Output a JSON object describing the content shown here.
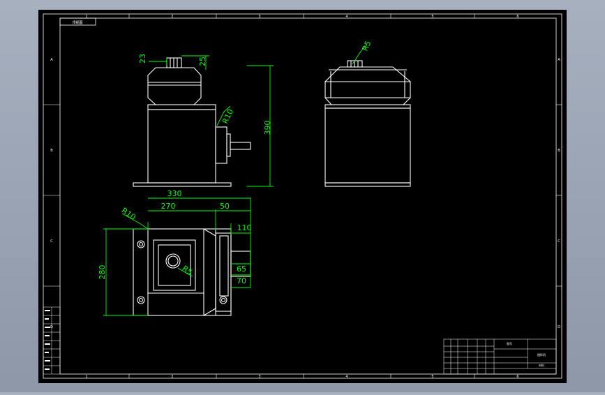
{
  "drawing": {
    "corner_stamp": "顶视图",
    "ruler_top": [
      "1",
      "2",
      "3",
      "4",
      "5",
      "6"
    ],
    "ruler_bottom": [
      "1",
      "2",
      "3",
      "4",
      "5",
      "6"
    ],
    "ruler_left": [
      "A",
      "B",
      "C",
      "D"
    ],
    "ruler_right": [
      "A",
      "B",
      "C",
      "D"
    ],
    "dimensions": {
      "d23": "23",
      "d25": "25",
      "d390": "390",
      "r10_front": "R10",
      "r5_side": "R5",
      "d330": "330",
      "d270": "270",
      "d50": "50",
      "d110": "110",
      "r10_top": "R10",
      "r5_top": "R5",
      "d280": "280",
      "d65": "65",
      "d70": "70"
    },
    "title_block": {
      "part_name": "搅拌机",
      "drawing_no": "图号",
      "material": "材料"
    },
    "colors": {
      "canvas": "#000000",
      "outline": "#ffffff",
      "dimension": "#00ff00",
      "background": "#9aa3b4"
    }
  }
}
